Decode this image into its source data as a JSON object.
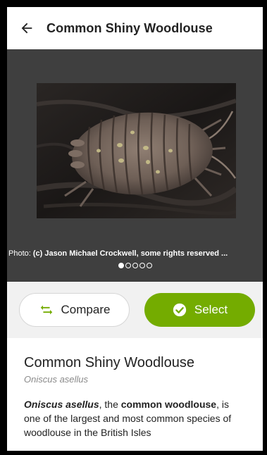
{
  "header": {
    "title": "Common Shiny Woodlouse",
    "back_icon": "arrow-left-icon"
  },
  "carousel": {
    "attribution_prefix": "Photo: ",
    "attribution_credit": "(c) Jason Michael Crockwell, some rights reserved ...",
    "photo_count": 5,
    "active_index": 0
  },
  "actions": {
    "compare_label": "Compare",
    "compare_icon": "swap-arrows-icon",
    "select_label": "Select",
    "select_icon": "check-circle-icon"
  },
  "taxon": {
    "common_name": "Common Shiny Woodlouse",
    "scientific_name": "Oniscus asellus"
  },
  "description": {
    "scientific": "Oniscus asellus",
    "part1": ", the ",
    "common": "common woodlouse",
    "part2": ", is one of the largest and most common species of woodlouse in the British Isles"
  },
  "colors": {
    "accent": "#74ac00",
    "compare_icon": "#74ac00",
    "carousel_bg": "#3f3f3f"
  }
}
